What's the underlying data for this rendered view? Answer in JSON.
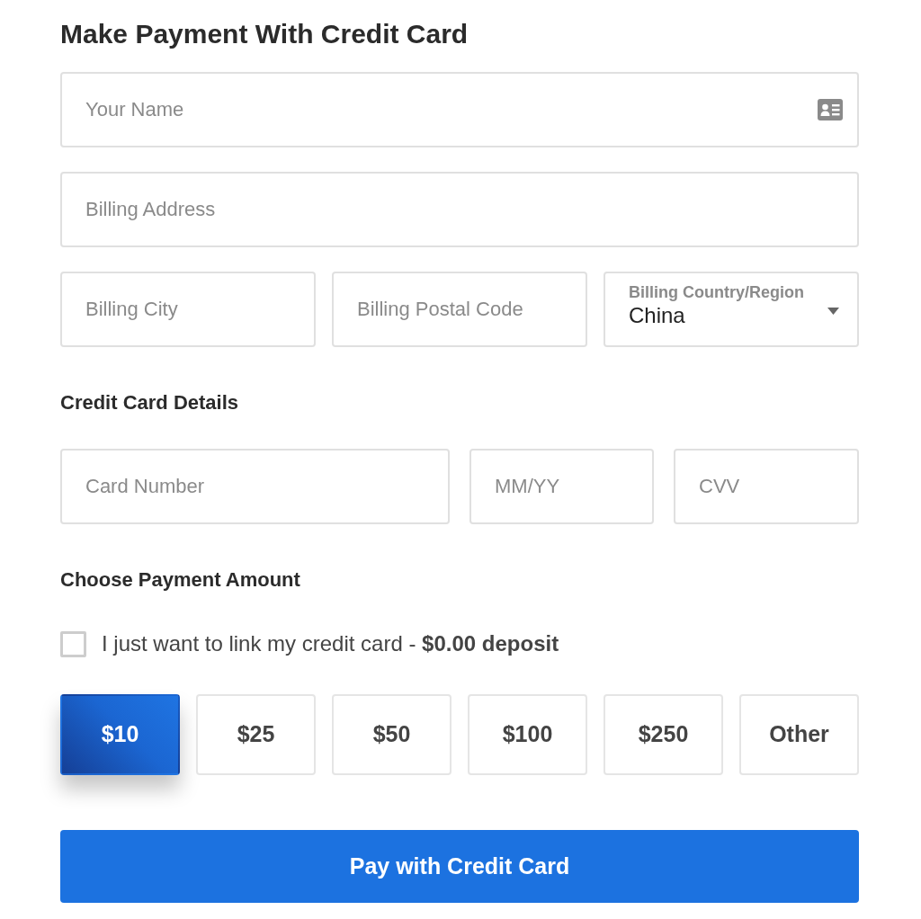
{
  "title": "Make Payment With Credit Card",
  "billing": {
    "rows": [
      {
        "fields": [
          {
            "kind": "icon_input",
            "placeholder": "Your Name"
          }
        ]
      },
      {
        "fields": [
          {
            "kind": "input",
            "placeholder": "Billing Address"
          }
        ]
      },
      {
        "fields": [
          {
            "kind": "input",
            "placeholder": "Billing City"
          },
          {
            "kind": "input",
            "placeholder": "Billing Postal Code"
          },
          {
            "kind": "select",
            "label": "Billing Country/Region",
            "value": "China"
          }
        ]
      }
    ]
  },
  "card_details": {
    "heading": "Credit Card Details",
    "fields": [
      {
        "placeholder": "Card Number"
      },
      {
        "placeholder": "MM/YY"
      },
      {
        "placeholder": "CVV"
      }
    ]
  },
  "payment_amount": {
    "heading": "Choose Payment Amount",
    "link_only": {
      "label": "I just want to link my credit card - **$0.00 deposit**",
      "checked": false
    },
    "amounts": [
      {
        "label": "$10",
        "selected": true
      },
      {
        "label": "$25",
        "selected": false
      },
      {
        "label": "$50",
        "selected": false
      },
      {
        "label": "$100",
        "selected": false
      },
      {
        "label": "$250",
        "selected": false
      },
      {
        "label": "Other",
        "selected": false
      }
    ]
  },
  "submit": {
    "label": "Pay with Credit Card"
  }
}
